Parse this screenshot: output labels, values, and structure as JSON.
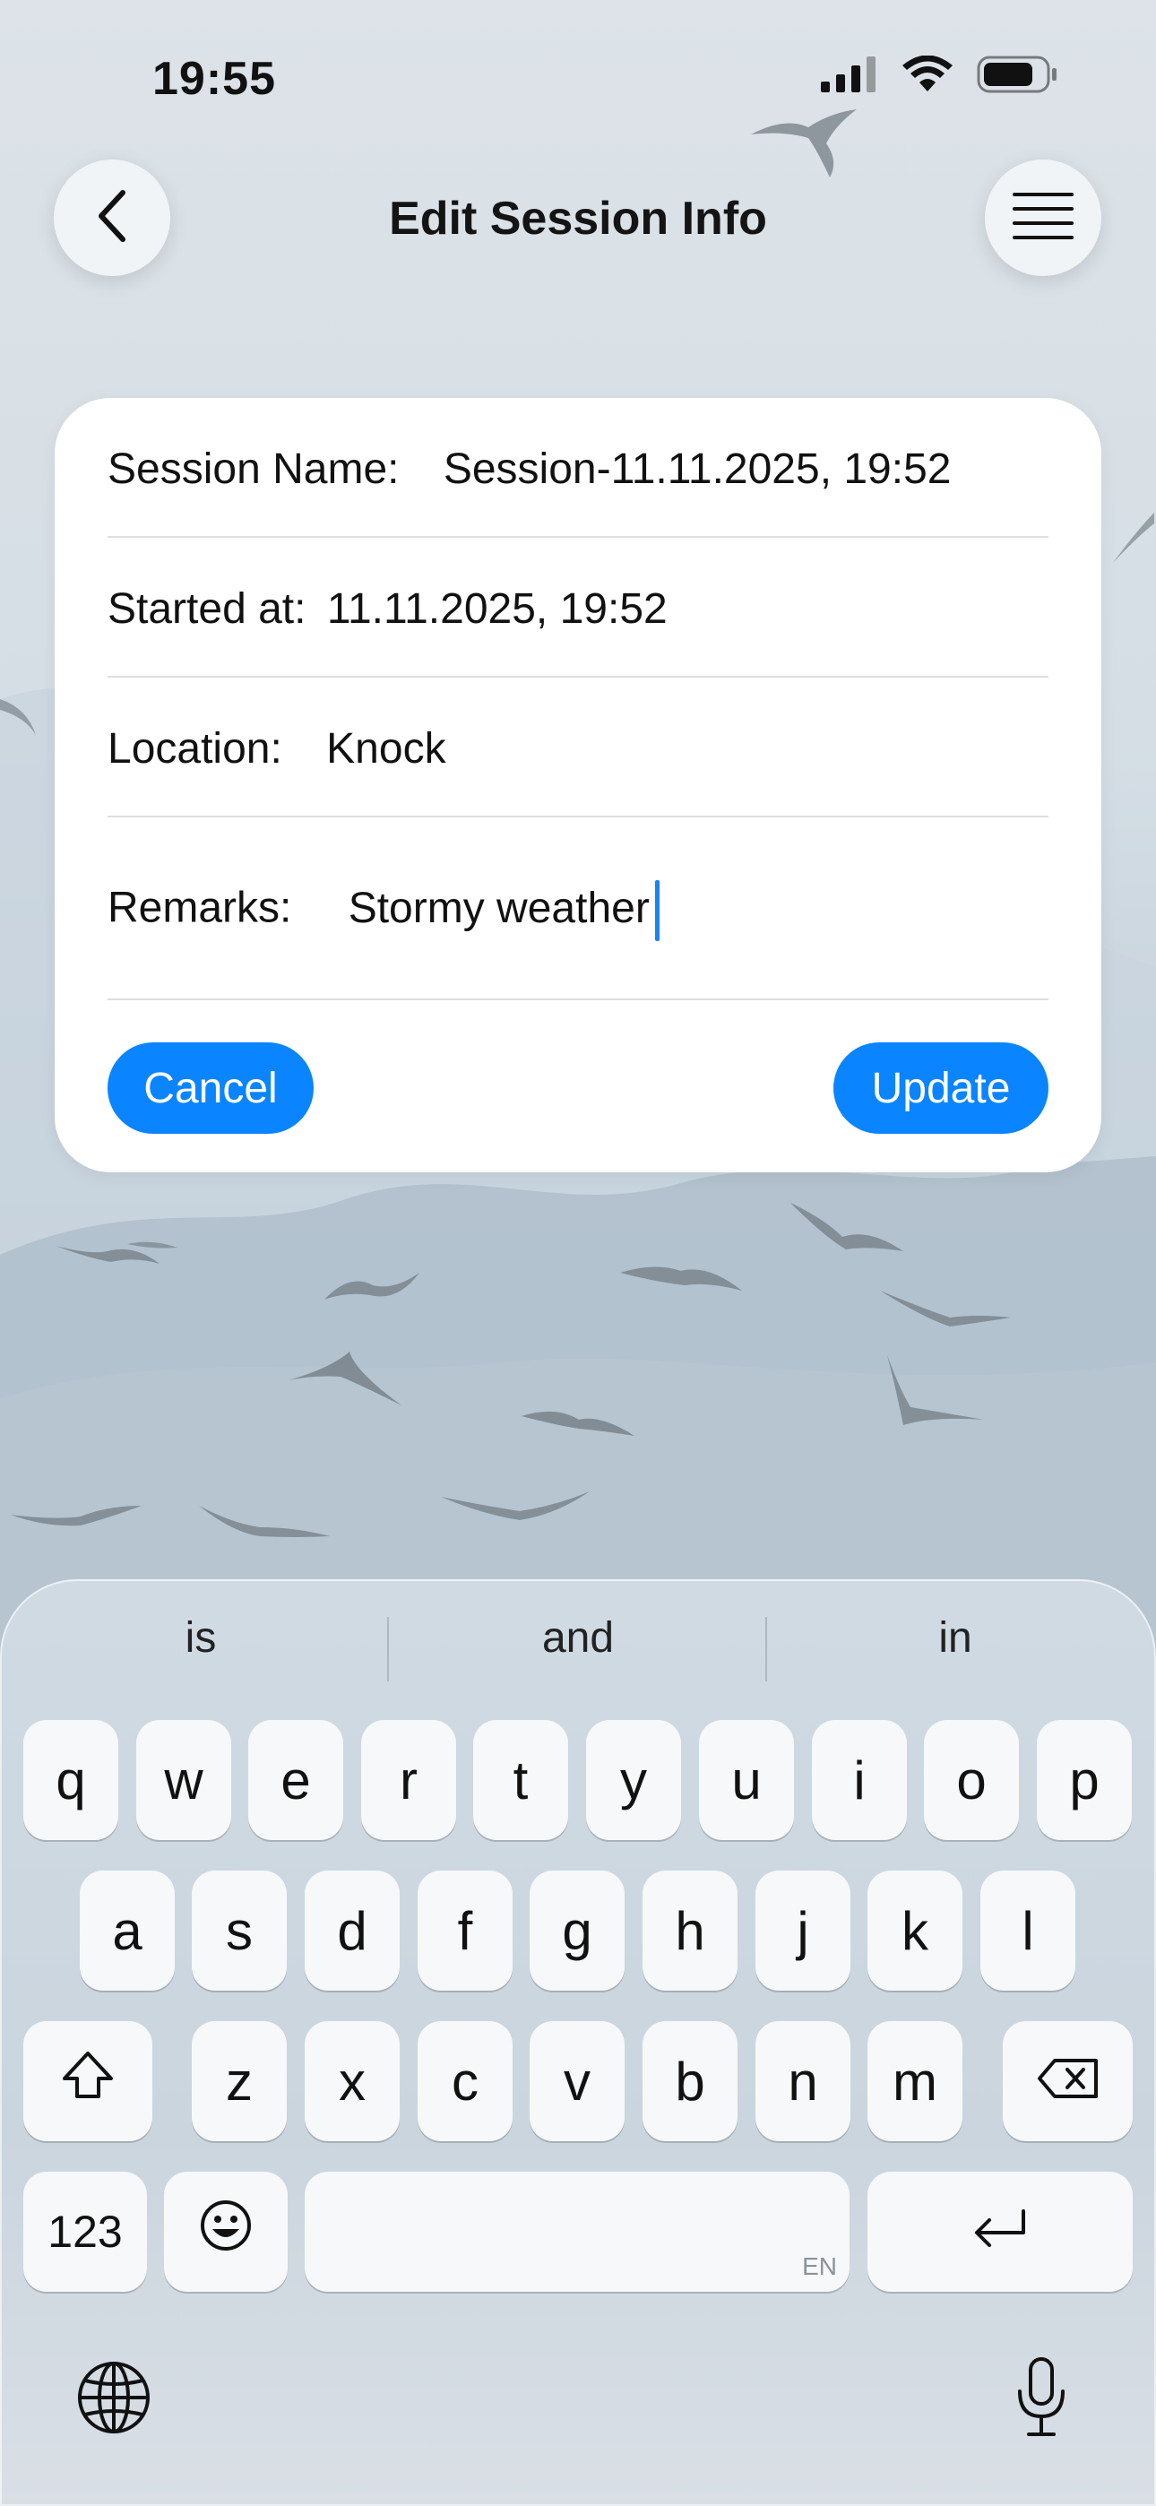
{
  "status": {
    "time": "19:55"
  },
  "header": {
    "title": "Edit Session Info"
  },
  "form": {
    "session_name_label": "Session Name:",
    "session_name_value": "Session-11.11.2025, 19:52",
    "started_label": "Started at:",
    "started_value": "11.11.2025, 19:52",
    "location_label": "Location:",
    "location_value": "Knock",
    "remarks_label": "Remarks:",
    "remarks_value": "Stormy weather",
    "cancel_label": "Cancel",
    "update_label": "Update"
  },
  "keyboard": {
    "suggestions": [
      "is",
      "and",
      "in"
    ],
    "row1": [
      "q",
      "w",
      "e",
      "r",
      "t",
      "y",
      "u",
      "i",
      "o",
      "p"
    ],
    "row2": [
      "a",
      "s",
      "d",
      "f",
      "g",
      "h",
      "j",
      "k",
      "l"
    ],
    "row3": [
      "z",
      "x",
      "c",
      "v",
      "b",
      "n",
      "m"
    ],
    "numbers_label": "123",
    "space_lang": "EN"
  },
  "colors": {
    "accent": "#0a84ff",
    "caret": "#1a84f0",
    "card": "#ffffff"
  },
  "icons": [
    "back-icon",
    "menu-icon",
    "signal-icon",
    "wifi-icon",
    "battery-icon",
    "shift-icon",
    "delete-icon",
    "emoji-icon",
    "return-icon",
    "globe-icon",
    "microphone-icon"
  ]
}
